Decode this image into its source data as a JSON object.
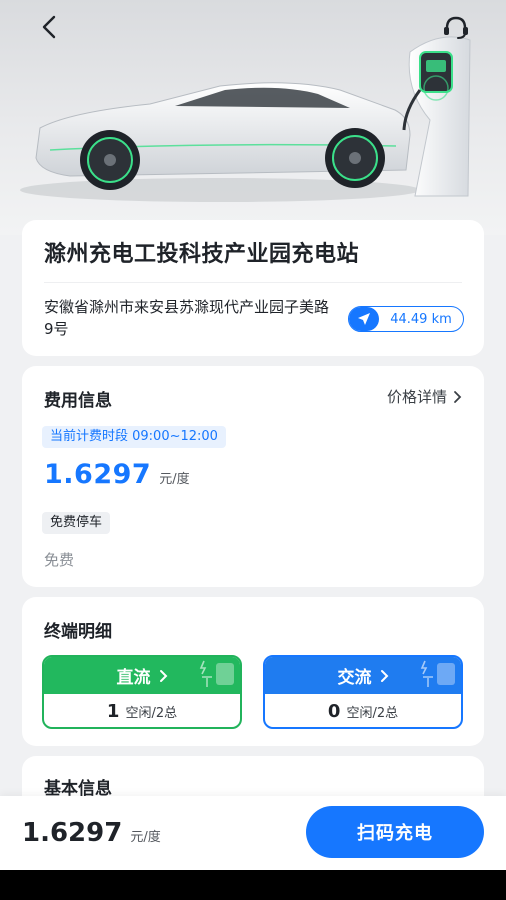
{
  "station": {
    "name": "滁州充电工投科技产业园充电站",
    "address": "安徽省滁州市来安县苏滁现代产业园子美路9号",
    "distance": "44.49 km"
  },
  "fee": {
    "title": "费用信息",
    "detail_link": "价格详情",
    "period": "当前计费时段 09:00~12:00",
    "price": "1.6297",
    "unit": "元/度",
    "parking_tag": "免费停车",
    "parking_value": "免费"
  },
  "terminal": {
    "title": "终端明细",
    "dc": {
      "label": "直流",
      "idle": "1",
      "status": "空闲/2总"
    },
    "ac": {
      "label": "交流",
      "idle": "0",
      "status": "空闲/2总"
    }
  },
  "basic": {
    "title": "基本信息"
  },
  "bottom": {
    "price": "1.6297",
    "unit": "元/度",
    "scan_label": "扫码充电"
  },
  "colors": {
    "accent": "#1677ff",
    "dc_green": "#22b85e"
  },
  "icons": [
    "back-icon",
    "headset-icon",
    "navigation-icon",
    "chevron-right-icon",
    "plug-icon"
  ]
}
